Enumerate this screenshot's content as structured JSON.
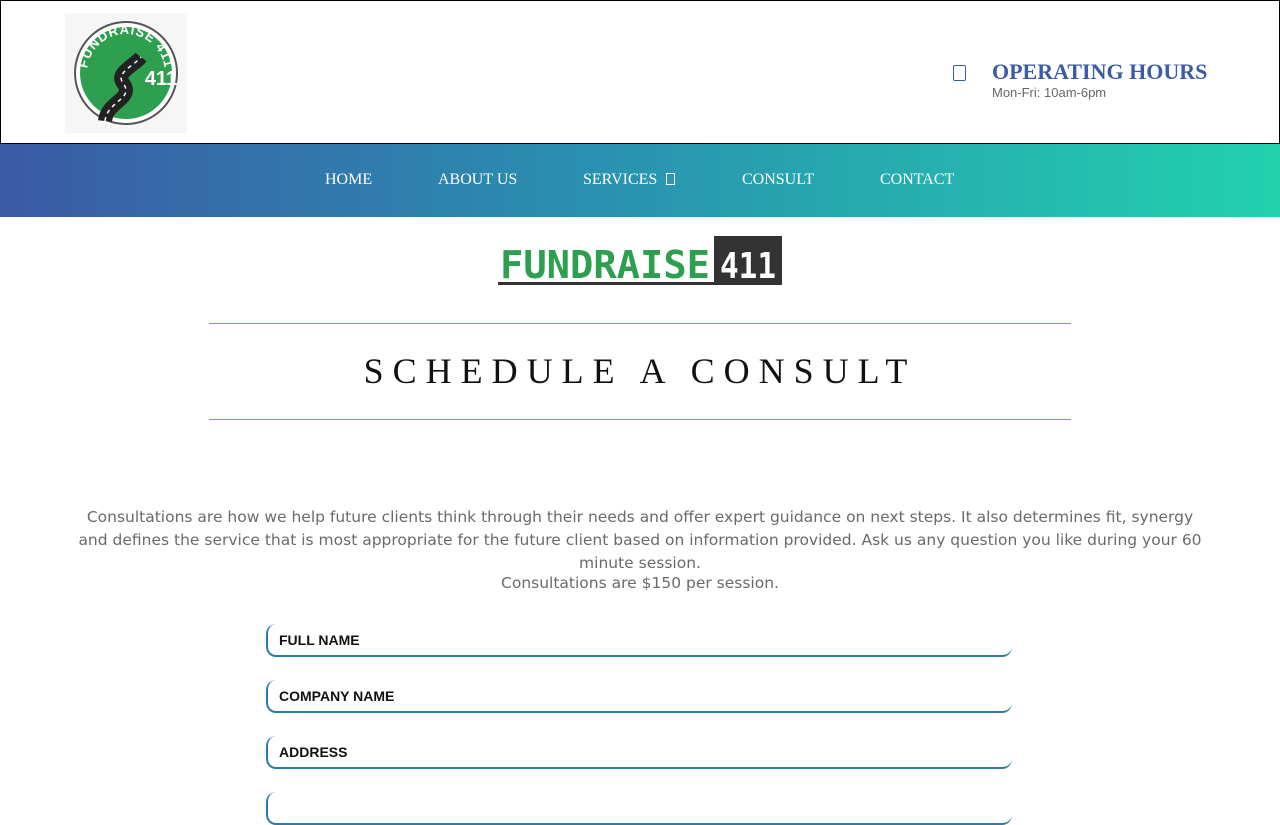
{
  "header": {
    "logo_text": "FUNDRAISE 411",
    "hours_title": "OPERATING HOURS",
    "hours_detail": "Mon-Fri: 10am-6pm"
  },
  "nav": {
    "items": [
      {
        "label": "HOME"
      },
      {
        "label": "ABOUT US"
      },
      {
        "label": "SERVICES",
        "has_submenu": true
      },
      {
        "label": "CONSULT"
      },
      {
        "label": "CONTACT"
      }
    ]
  },
  "brand": {
    "logo_text_green": "FUNDRAISE",
    "logo_text_dark": "411"
  },
  "main": {
    "title": "SCHEDULE A CONSULT",
    "intro": "Consultations are how we help future clients think through their needs and offer expert guidance on next steps. It also determines fit, synergy and defines the service that is most appropriate for the future client based on information provided. Ask us any question you like during your 60 minute session.",
    "price_note": "Consultations are $150 per session."
  },
  "form": {
    "fields": [
      {
        "placeholder": "FULL NAME",
        "value": ""
      },
      {
        "placeholder": "COMPANY NAME",
        "value": ""
      },
      {
        "placeholder": "ADDRESS",
        "value": ""
      },
      {
        "placeholder": "",
        "value": ""
      }
    ]
  },
  "colors": {
    "brand_green": "#2e9e4f",
    "nav_gradient_start": "#3b5aa6",
    "nav_gradient_end": "#22d1ad",
    "accent_blue": "#3b5ba6",
    "rule_teal": "#2cb6c3"
  }
}
